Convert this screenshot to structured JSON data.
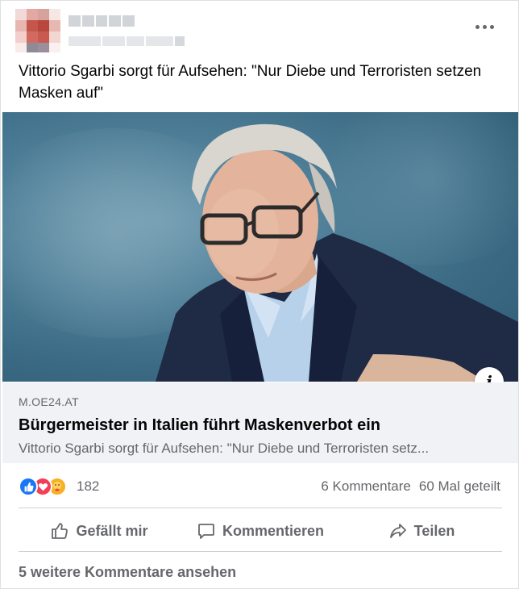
{
  "post": {
    "text": "Vittorio Sgarbi sorgt für Aufsehen: \"Nur Diebe und Terroristen setzen Masken auf\"",
    "more_icon": "more-horizontal-icon"
  },
  "link_preview": {
    "domain": "M.OE24.AT",
    "title": "Bürgermeister in Italien führt Maskenverbot ein",
    "description": "Vittorio Sgarbi sorgt für Aufsehen: \"Nur Diebe und Terroristen setz...",
    "info_icon": "i"
  },
  "reactions": {
    "icons": [
      "like-icon",
      "love-icon",
      "care-icon"
    ],
    "count": "182",
    "comments": "6 Kommentare",
    "shares": "60 Mal geteilt"
  },
  "actions": {
    "like": "Gefällt mir",
    "comment": "Kommentieren",
    "share": "Teilen"
  },
  "footer": {
    "more_comments": "5 weitere Kommentare ansehen"
  },
  "colors": {
    "facebook_blue": "#1877f2",
    "secondary_text": "#65676b",
    "preview_bg": "#f0f2f5"
  }
}
